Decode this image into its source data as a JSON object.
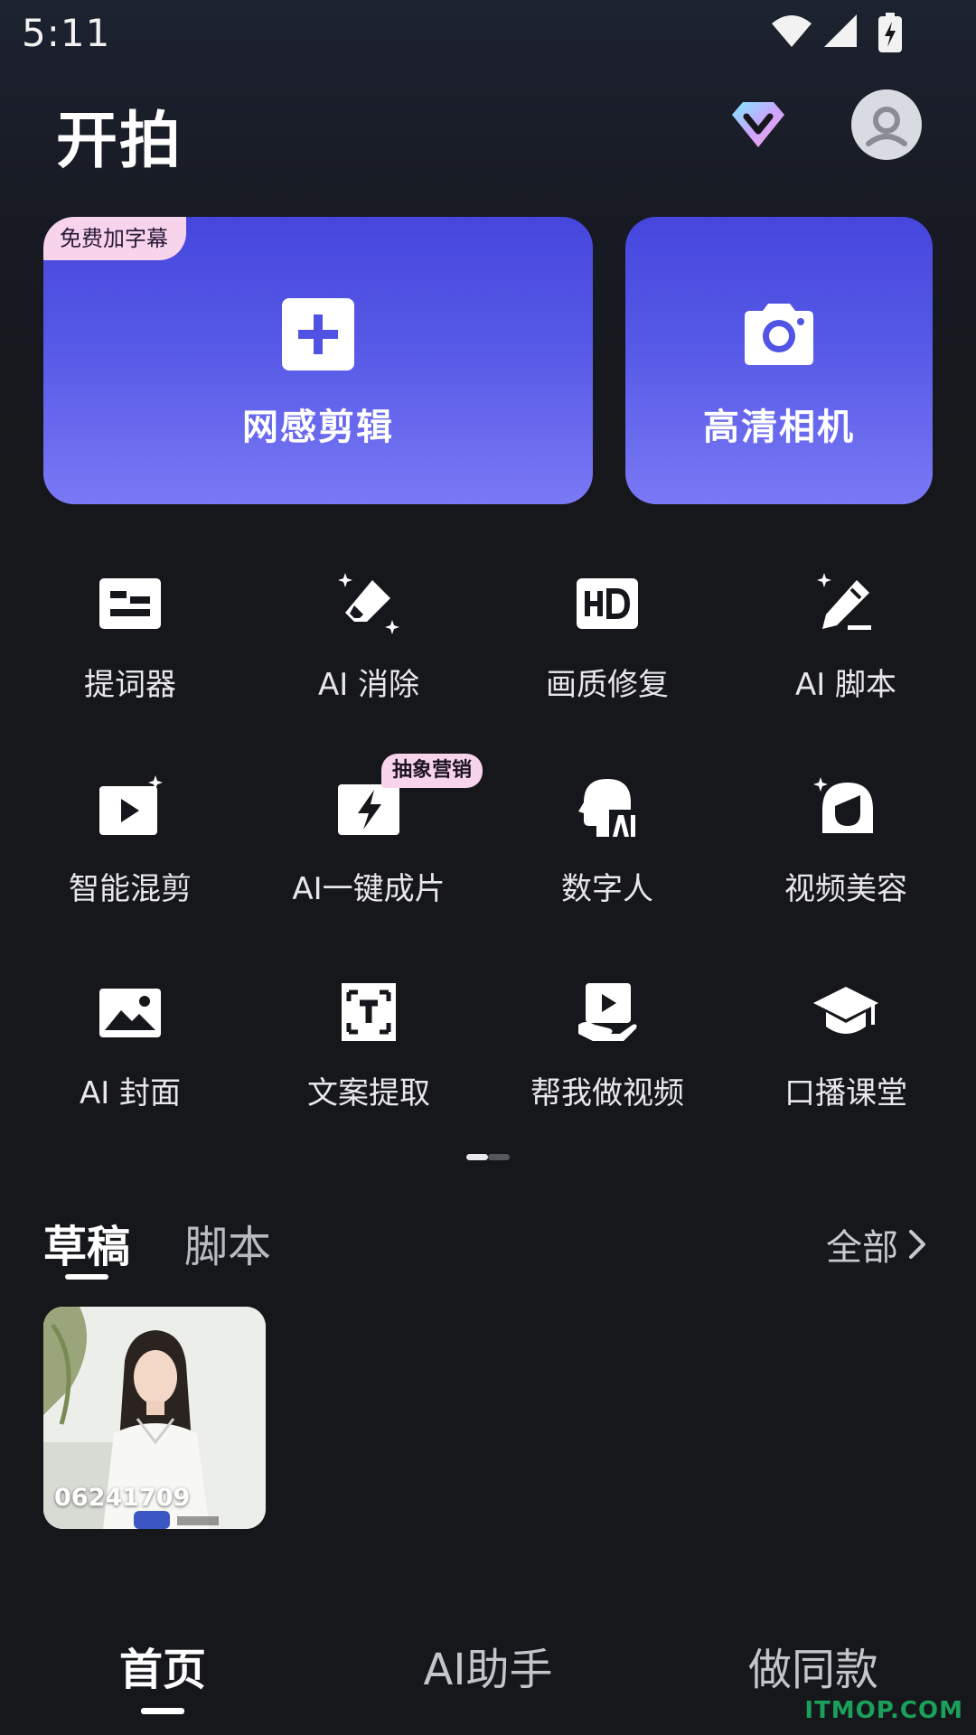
{
  "status_bar": {
    "time": "5:11"
  },
  "header": {
    "title": "开拍",
    "vip_icon": "diamond-vip-icon",
    "avatar_icon": "user-avatar-icon"
  },
  "hero": {
    "edit": {
      "badge": "免费加字幕",
      "label": "网感剪辑",
      "icon": "plus-square-icon"
    },
    "camera": {
      "label": "高清相机",
      "icon": "camera-icon"
    }
  },
  "tools": [
    {
      "label": "提词器",
      "icon": "teleprompter-icon"
    },
    {
      "label": "AI 消除",
      "icon": "eraser-sparkle-icon"
    },
    {
      "label": "画质修复",
      "icon": "hd-icon"
    },
    {
      "label": "AI 脚本",
      "icon": "pen-sparkle-icon"
    },
    {
      "label": "智能混剪",
      "icon": "video-sparkle-icon"
    },
    {
      "label": "AI一键成片",
      "icon": "lightning-icon",
      "badge": "抽象营销"
    },
    {
      "label": "数字人",
      "icon": "ai-head-icon"
    },
    {
      "label": "视频美容",
      "icon": "beauty-face-icon"
    },
    {
      "label": "AI 封面",
      "icon": "image-icon"
    },
    {
      "label": "文案提取",
      "icon": "text-scan-icon"
    },
    {
      "label": "帮我做视频",
      "icon": "hand-video-icon"
    },
    {
      "label": "口播课堂",
      "icon": "graduation-cap-icon"
    }
  ],
  "pager": {
    "pages": 2,
    "current": 1
  },
  "section": {
    "tab_drafts": "草稿",
    "tab_scripts": "脚本",
    "view_all": "全部"
  },
  "drafts": [
    {
      "name": "06241709"
    }
  ],
  "bottom_nav": {
    "home": "首页",
    "ai": "AI助手",
    "same": "做同款"
  },
  "watermark": "ITMOP.COM",
  "colors": {
    "accent": "#5659e6",
    "badge_pink": "#f8d3ec",
    "background": "#16171b"
  }
}
